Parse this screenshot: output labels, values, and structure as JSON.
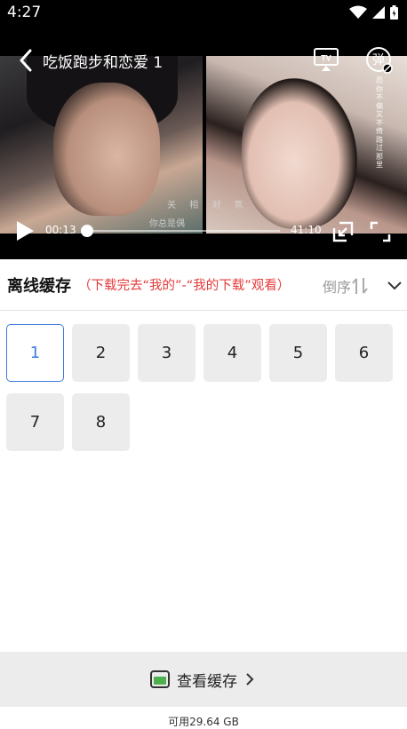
{
  "status_bar": {
    "time": "4:27",
    "icons": [
      "wifi-icon",
      "signal-icon",
      "battery-icon"
    ]
  },
  "video": {
    "title": "吃饭跑步和恋爱 1",
    "subtitle_left": "你总是偶",
    "subtitle_right": "关 相 对 氛",
    "danmu_label": "弹",
    "overlay_vertical_text": "而你不偏又不倚路过那里",
    "current_time": "00:13",
    "total_time": "41:10",
    "progress_fraction": 0.005
  },
  "cache": {
    "title": "离线缓存",
    "hint": "（下载完去“我的”-“我的下载”观看）",
    "sort_label": "倒序"
  },
  "episodes": [
    {
      "label": "1",
      "selected": true
    },
    {
      "label": "2",
      "selected": false
    },
    {
      "label": "3",
      "selected": false
    },
    {
      "label": "4",
      "selected": false
    },
    {
      "label": "5",
      "selected": false
    },
    {
      "label": "6",
      "selected": false
    },
    {
      "label": "7",
      "selected": false
    },
    {
      "label": "8",
      "selected": false
    }
  ],
  "footer": {
    "view_cache_label": "查看缓存",
    "storage_text": "可用29.64 GB"
  },
  "colors": {
    "accent": "#3c7be0",
    "hint_red": "#e53a3a",
    "bar_bg": "#ececec"
  }
}
